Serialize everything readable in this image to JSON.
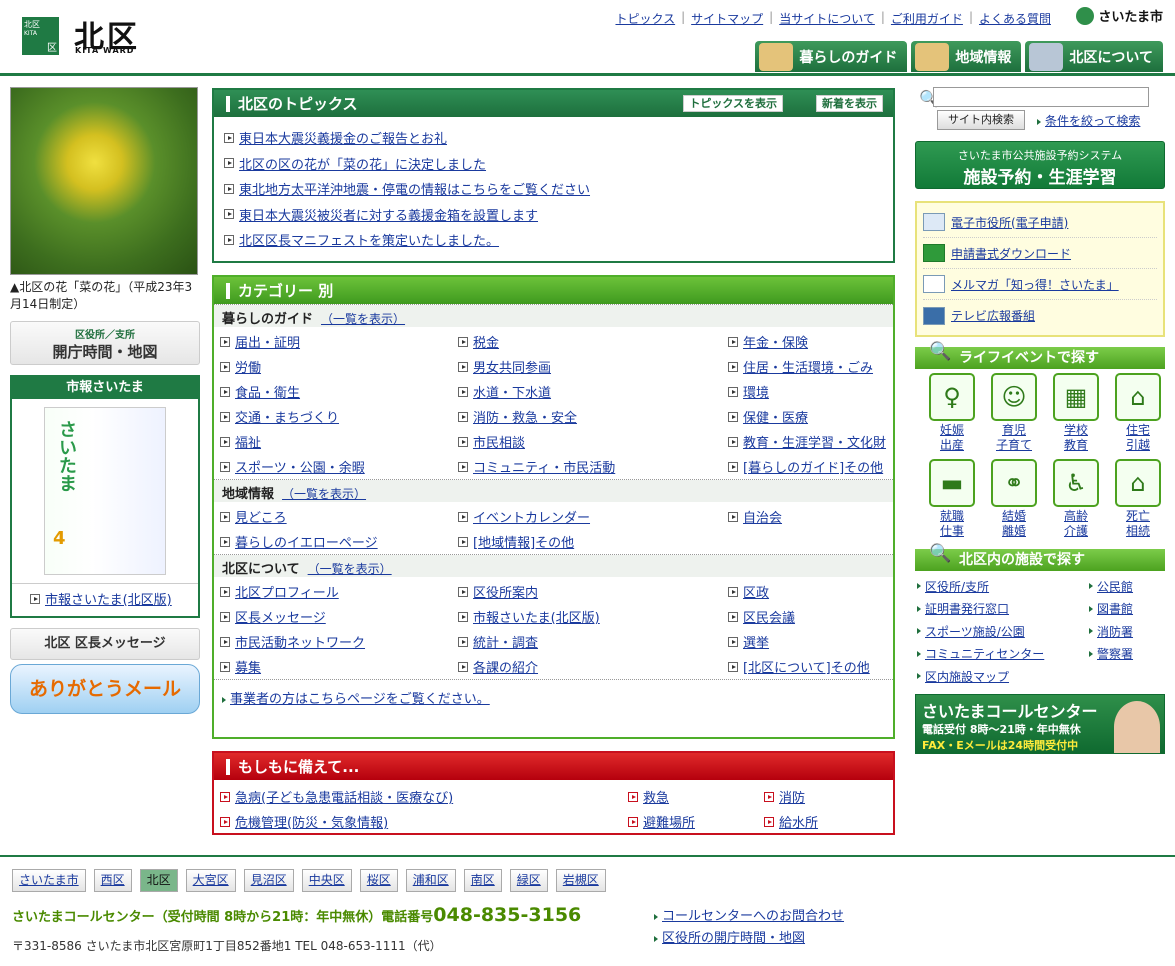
{
  "header": {
    "badge_top": "北区",
    "badge_sub": "KITA",
    "badge_corner": "区",
    "title": "北区",
    "title_en": "KITA WARD",
    "city": "さいたま市",
    "util": [
      "トピックス",
      "サイトマップ",
      "当サイトについて",
      "ご利用ガイド",
      "よくある質問"
    ],
    "nav": [
      "暮らしのガイド",
      "地域情報",
      "北区について"
    ]
  },
  "left": {
    "caption": "▲北区の花「菜の花」（平成23年3月14日制定）",
    "hours_small": "区役所／支所",
    "hours": "開庁時間・地図",
    "shiho_title": "市報さいたま",
    "shiho_cover": "さいたま",
    "shiho_num": "4",
    "shiho_link": "市報さいたま(北区版)",
    "mayor": "北区 区長メッセージ",
    "thanks": "ありがとうメール"
  },
  "topics": {
    "title": "北区のトピックス",
    "btn1": "トピックスを表示",
    "btn2": "新着を表示",
    "items": [
      "東日本大震災義援金のご報告とお礼",
      "北区の区の花が「菜の花」に決定しました",
      "東北地方太平洋沖地震・停電の情報はこちらをご覧ください",
      "東日本大震災被災者に対する義援金箱を設置します",
      "北区区長マニフェストを策定いたしました。"
    ]
  },
  "category": {
    "title": "カテゴリー 別",
    "more": "（一覧を表示）",
    "sections": [
      {
        "name": "暮らしのガイド",
        "items": [
          "届出・証明",
          "税金",
          "年金・保険",
          "労働",
          "男女共同参画",
          "住居・生活環境・ごみ",
          "食品・衛生",
          "水道・下水道",
          "環境",
          "交通・まちづくり",
          "消防・救急・安全",
          "保健・医療",
          "福祉",
          "市民相談",
          "教育・生涯学習・文化財",
          "スポーツ・公園・余暇",
          "コミュニティ・市民活動",
          "[暮らしのガイド]その他"
        ]
      },
      {
        "name": "地域情報",
        "items": [
          "見どころ",
          "イベントカレンダー",
          "自治会",
          "暮らしのイエローページ",
          "[地域情報]その他"
        ]
      },
      {
        "name": "北区について",
        "items": [
          "北区プロフィール",
          "区役所案内",
          "区政",
          "区長メッセージ",
          "市報さいたま(北区版)",
          "区民会議",
          "市民活動ネットワーク",
          "統計・調査",
          "選挙",
          "募集",
          "各課の紹介",
          "[北区について]その他"
        ]
      }
    ],
    "biz": "事業者の方はこちらページをご覧ください。"
  },
  "emergency": {
    "title": "もしもに備えて...",
    "items": [
      "急病(子ども急患電話相談・医療なび)",
      "救急",
      "消防",
      "危機管理(防災・気象情報)",
      "避難場所",
      "給水所"
    ]
  },
  "right": {
    "search_btn": "サイト内検索",
    "search_cond": "条件を絞って検索",
    "reserve_small": "さいたま市公共施設予約システム",
    "reserve": "施設予約・生涯学習",
    "eserv": [
      "電子市役所(電子申請)",
      "申請書式ダウンロード",
      "メルマガ「知っ得！さいたま」",
      "テレビ広報番組"
    ],
    "life_title": "ライフイベントで探す",
    "life": [
      {
        "l1": "妊娠",
        "l2": "出産"
      },
      {
        "l1": "育児",
        "l2": "子育て"
      },
      {
        "l1": "学校",
        "l2": "教育"
      },
      {
        "l1": "住宅",
        "l2": "引越"
      },
      {
        "l1": "就職",
        "l2": "仕事"
      },
      {
        "l1": "結婚",
        "l2": "離婚"
      },
      {
        "l1": "高齢",
        "l2": "介護"
      },
      {
        "l1": "死亡",
        "l2": "相続"
      }
    ],
    "fac_title": "北区内の施設で探す",
    "fac": [
      "区役所/支所",
      "公民館",
      "証明書発行窓口",
      "図書館",
      "スポーツ施設/公園",
      "消防署",
      "コミュニティセンター",
      "警察署",
      "区内施設マップ",
      ""
    ],
    "call_title": "さいたまコールセンター",
    "call_hours": "電話受付 8時〜21時・年中無休",
    "call_fax": "FAX・Eメールは24時間受付中"
  },
  "footer": {
    "wards": [
      "さいたま市",
      "西区",
      "北区",
      "大宮区",
      "見沼区",
      "中央区",
      "桜区",
      "浦和区",
      "南区",
      "緑区",
      "岩槻区"
    ],
    "cc": "さいたまコールセンター（受付時間 8時から21時：年中無休）電話番号",
    "tel": "048-835-3156",
    "addr": "〒331-8586 さいたま市北区宮原町1丁目852番地1 TEL 048-653-1111（代）",
    "links": [
      "コールセンターへのお問合わせ",
      "区役所の開庁時間・地図"
    ]
  }
}
